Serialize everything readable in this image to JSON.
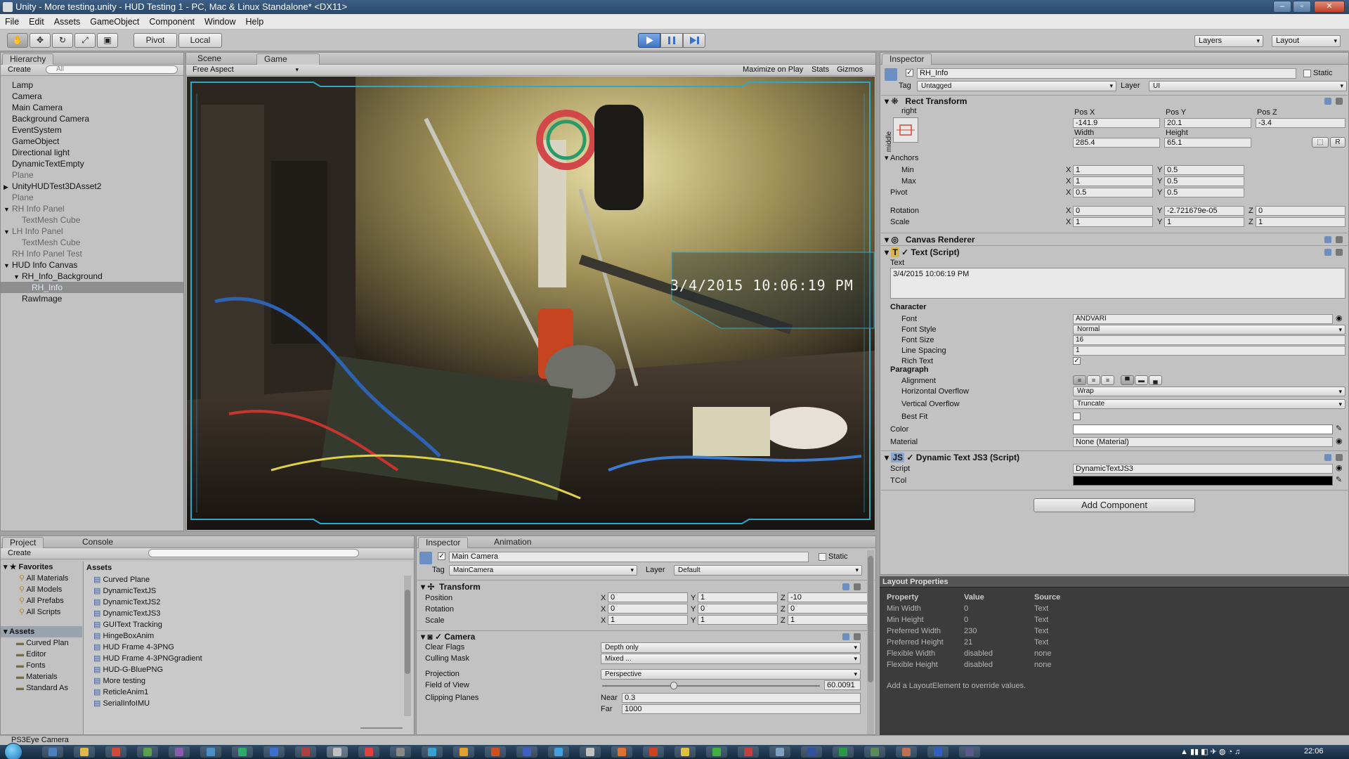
{
  "window": {
    "title": "Unity - More testing.unity - HUD Testing 1 - PC, Mac & Linux Standalone* <DX11>"
  },
  "menu": [
    "File",
    "Edit",
    "Assets",
    "GameObject",
    "Component",
    "Window",
    "Help"
  ],
  "toolbar": {
    "pivot": "Pivot",
    "local": "Local",
    "layers": "Layers",
    "layout": "Layout"
  },
  "hierarchy": {
    "tab": "Hierarchy",
    "create": "Create",
    "search_placeholder": "All",
    "items": [
      {
        "label": "Lamp",
        "depth": 0
      },
      {
        "label": "Camera",
        "depth": 0
      },
      {
        "label": "Main Camera",
        "depth": 0
      },
      {
        "label": "Background Camera",
        "depth": 0
      },
      {
        "label": "EventSystem",
        "depth": 0
      },
      {
        "label": "GameObject",
        "depth": 0
      },
      {
        "label": "Directional light",
        "depth": 0
      },
      {
        "label": "DynamicTextEmpty",
        "depth": 0
      },
      {
        "label": "Plane",
        "depth": 0,
        "grey": true
      },
      {
        "label": "UnityHUDTest3DAsset2",
        "depth": 0,
        "arrow": "right"
      },
      {
        "label": "Plane",
        "depth": 0,
        "grey": true
      },
      {
        "label": "RH Info Panel",
        "depth": 0,
        "arrow": "down",
        "grey": true
      },
      {
        "label": "TextMesh Cube",
        "depth": 1,
        "grey": true
      },
      {
        "label": "LH Info Panel",
        "depth": 0,
        "arrow": "down",
        "grey": true
      },
      {
        "label": "TextMesh Cube",
        "depth": 1,
        "grey": true
      },
      {
        "label": "RH Info Panel Test",
        "depth": 0,
        "grey": true
      },
      {
        "label": "HUD Info Canvas",
        "depth": 0,
        "arrow": "down"
      },
      {
        "label": "RH_Info_Background",
        "depth": 1,
        "arrow": "down"
      },
      {
        "label": "RH_Info",
        "depth": 2,
        "selected": true
      },
      {
        "label": "RawImage",
        "depth": 1
      }
    ]
  },
  "scene_tab": "Scene",
  "game_tab": "Game",
  "game": {
    "aspect": "Free Aspect",
    "maximize": "Maximize on Play",
    "stats": "Stats",
    "gizmos": "Gizmos",
    "hud_text": "3/4/2015 10:06:19 PM"
  },
  "project": {
    "tab": "Project",
    "console_tab": "Console",
    "create": "Create",
    "favorites_label": "Favorites",
    "favorites": [
      "All Materials",
      "All Models",
      "All Prefabs",
      "All Scripts"
    ],
    "assets_label": "Assets",
    "assets_tree": [
      "Curved Plan",
      "Editor",
      "Fonts",
      "Materials",
      "Standard As"
    ],
    "breadcrumb": "Assets",
    "files": [
      "Curved Plane",
      "DynamicTextJS",
      "DynamicTextJS2",
      "DynamicTextJS3",
      "GUIText Tracking",
      "HingeBoxAnim",
      "HUD Frame 4-3PNG",
      "HUD Frame 4-3PNGgradient",
      "HUD-G-BluePNG",
      "More testing",
      "ReticleAnim1",
      "SerialInfoIMU"
    ]
  },
  "inspector_bottom": {
    "tab": "Inspector",
    "anim_tab": "Animation",
    "name": "Main Camera",
    "static": "Static",
    "tag_label": "Tag",
    "tag": "MainCamera",
    "layer_label": "Layer",
    "layer": "Default",
    "transform": {
      "title": "Transform",
      "position_label": "Position",
      "rotation_label": "Rotation",
      "scale_label": "Scale",
      "pos": [
        "0",
        "1",
        "-10"
      ],
      "rot": [
        "0",
        "0",
        "0"
      ],
      "scale": [
        "1",
        "1",
        "1"
      ]
    },
    "camera": {
      "title": "Camera",
      "clear_flags_label": "Clear Flags",
      "clear_flags": "Depth only",
      "culling_label": "Culling Mask",
      "culling": "Mixed ...",
      "projection_label": "Projection",
      "projection": "Perspective",
      "fov_label": "Field of View",
      "fov": "60.0091",
      "fov_fraction": 0.33,
      "clipping_label": "Clipping Planes",
      "near_label": "Near",
      "near": "0.3",
      "far_label": "Far",
      "far": "1000"
    }
  },
  "inspector": {
    "tab": "Inspector",
    "name": "RH_Info",
    "static": "Static",
    "tag_label": "Tag",
    "tag": "Untagged",
    "layer_label": "Layer",
    "layer": "UI",
    "rect": {
      "title": "Rect Transform",
      "anchor_h": "right",
      "anchor_v": "middle",
      "posx_label": "Pos X",
      "posy_label": "Pos Y",
      "posz_label": "Pos Z",
      "posx": "-141.9",
      "posy": "20.1",
      "posz": "-3.4",
      "width_label": "Width",
      "height_label": "Height",
      "width": "285.4",
      "height": "65.1",
      "r_btn": "R",
      "anchors_label": "Anchors",
      "min_label": "Min",
      "max_label": "Max",
      "min_x": "1",
      "min_y": "0.5",
      "max_x": "1",
      "max_y": "0.5",
      "pivot_label": "Pivot",
      "pivot_x": "0.5",
      "pivot_y": "0.5",
      "rotation_label": "Rotation",
      "rot_x": "0",
      "rot_y": "-2.721679e-05",
      "rot_z": "0",
      "scale_label": "Scale",
      "scale_x": "1",
      "scale_y": "1",
      "scale_z": "1"
    },
    "canvas_renderer": "Canvas Renderer",
    "text_script": {
      "title": "Text (Script)",
      "text_label": "Text",
      "text": "3/4/2015 10:06:19 PM",
      "character_label": "Character",
      "font_label": "Font",
      "font": "ANDVARI",
      "font_style_label": "Font Style",
      "font_style": "Normal",
      "font_size_label": "Font Size",
      "font_size": "16",
      "line_spacing_label": "Line Spacing",
      "line_spacing": "1",
      "rich_text_label": "Rich Text",
      "paragraph_label": "Paragraph",
      "alignment_label": "Alignment",
      "h_overflow_label": "Horizontal Overflow",
      "h_overflow": "Wrap",
      "v_overflow_label": "Vertical Overflow",
      "v_overflow": "Truncate",
      "best_fit_label": "Best Fit",
      "color_label": "Color",
      "material_label": "Material",
      "material": "None (Material)"
    },
    "dyn_script": {
      "title": "Dynamic Text JS3 (Script)",
      "script_label": "Script",
      "script": "DynamicTextJS3",
      "tcol_label": "TCol"
    },
    "add_component": "Add Component"
  },
  "layout_props": {
    "title": "Layout Properties",
    "headers": [
      "Property",
      "Value",
      "Source"
    ],
    "rows": [
      [
        "Min Width",
        "0",
        "Text"
      ],
      [
        "Min Height",
        "0",
        "Text"
      ],
      [
        "Preferred Width",
        "230",
        "Text"
      ],
      [
        "Preferred Height",
        "21",
        "Text"
      ],
      [
        "Flexible Width",
        "disabled",
        "none"
      ],
      [
        "Flexible Height",
        "disabled",
        "none"
      ]
    ],
    "note": "Add a LayoutElement to override values."
  },
  "status": "PS3Eye Camera",
  "clock": "22:06",
  "colors": {
    "accent": "#3a7bd5",
    "hud_frame": "#2fa8c8",
    "selected": "#8e8e8e"
  }
}
